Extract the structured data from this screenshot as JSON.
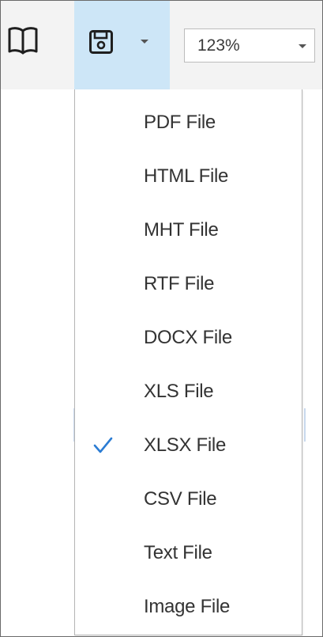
{
  "toolbar": {
    "book_icon": "open-book-icon",
    "save_icon": "floppy-disk-icon",
    "save_dropdown_icon": "caret-down-icon",
    "zoom": {
      "value": "123%",
      "dropdown_icon": "caret-down-icon"
    },
    "colors": {
      "toolbar_bg": "#f3f3f3",
      "active_button_bg": "#cde6f7",
      "check_color": "#2b7cd3"
    }
  },
  "export_menu": {
    "items": [
      {
        "label": "PDF File",
        "checked": false
      },
      {
        "label": "HTML File",
        "checked": false
      },
      {
        "label": "MHT File",
        "checked": false
      },
      {
        "label": "RTF File",
        "checked": false
      },
      {
        "label": "DOCX File",
        "checked": false
      },
      {
        "label": "XLS File",
        "checked": false
      },
      {
        "label": "XLSX File",
        "checked": true
      },
      {
        "label": "CSV File",
        "checked": false
      },
      {
        "label": "Text File",
        "checked": false
      },
      {
        "label": "Image File",
        "checked": false
      }
    ],
    "check_icon": "checkmark-icon"
  }
}
